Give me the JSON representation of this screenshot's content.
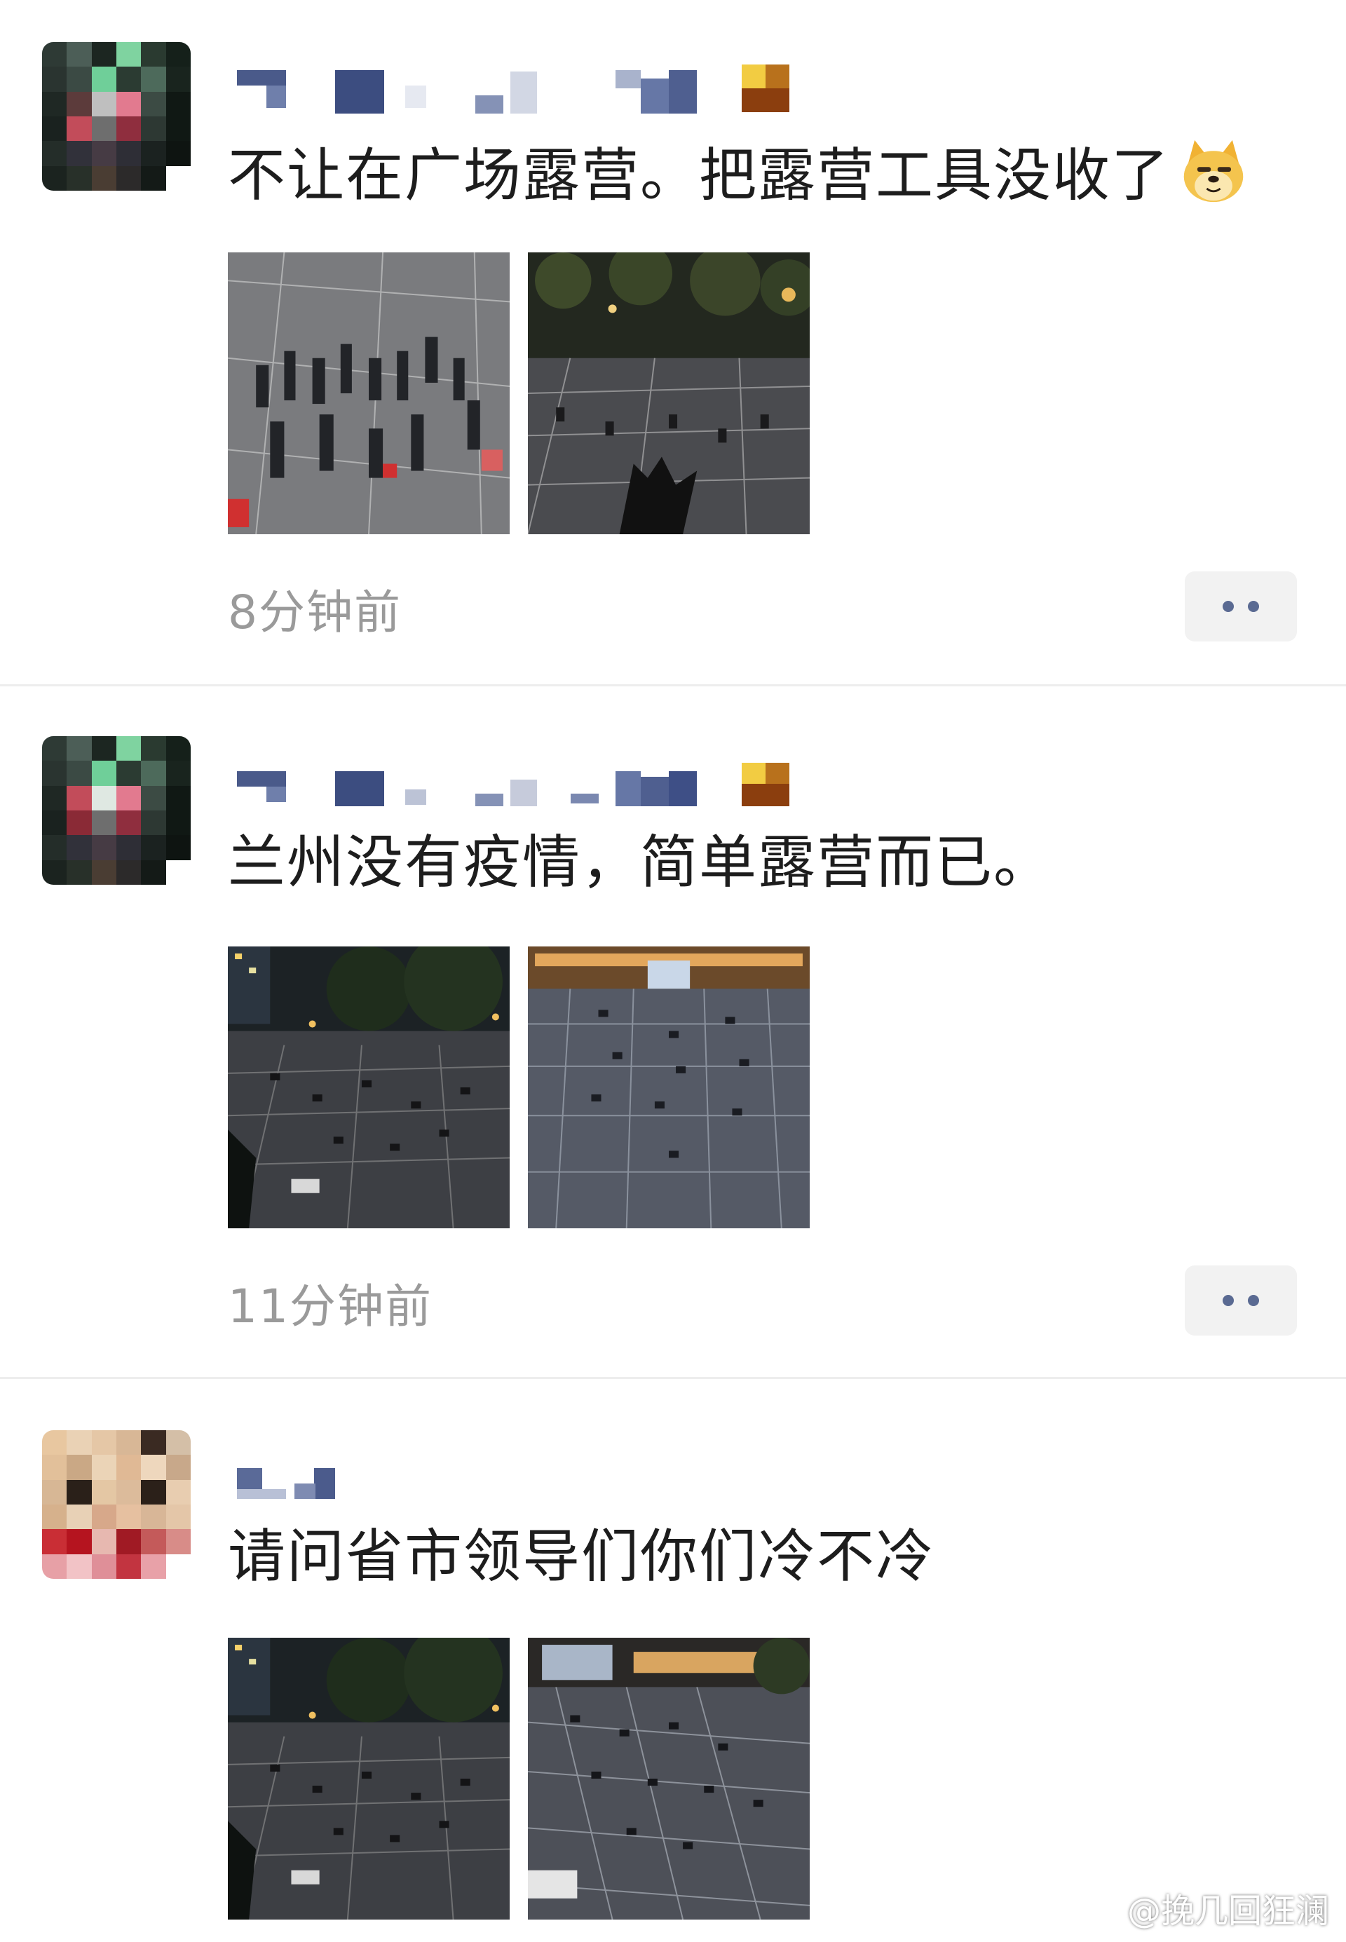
{
  "posts": [
    {
      "text": "不让在广场露营。把露营工具没收了",
      "emoji": "doge-emoji",
      "time": "8分钟前",
      "photos": [
        "plaza-crowd-photo",
        "plaza-night-photo"
      ]
    },
    {
      "text": "兰州没有疫情，简单露营而已。",
      "time": "11分钟前",
      "photos": [
        "plaza-grid-photo",
        "plaza-grid-photo-2"
      ]
    },
    {
      "text": "请问省市领导们你们冷不冷",
      "photos": [
        "plaza-grid-photo-3",
        "plaza-grid-photo-4"
      ]
    }
  ],
  "icons": {
    "more": "more-dots-icon",
    "weibo": "weibo-logo-icon"
  },
  "colors": {
    "text": "#1d1d1d",
    "time": "#9a9a9a",
    "button_bg": "#f2f2f2",
    "dots": "#5a6a92",
    "divider": "#ededed"
  },
  "watermark": {
    "text": "@挽几回狂澜"
  }
}
